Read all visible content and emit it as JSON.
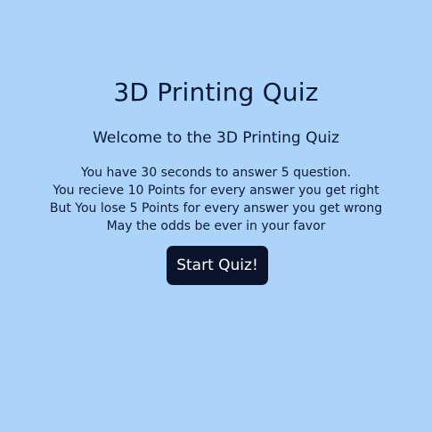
{
  "colors": {
    "background": "#acd3fa",
    "text": "#0b1a36",
    "button_bg": "#0b132b",
    "button_text": "#ffffff"
  },
  "quiz": {
    "title": "3D Printing Quiz",
    "welcome": "Welcome to the 3D Printing Quiz",
    "rules": [
      "You have 30 seconds to answer 5 question.",
      "You recieve 10 Points for every answer you get right",
      "But You lose 5 Points for every answer you get wrong",
      "May the odds be ever in your favor"
    ],
    "start_label": "Start Quiz!"
  }
}
